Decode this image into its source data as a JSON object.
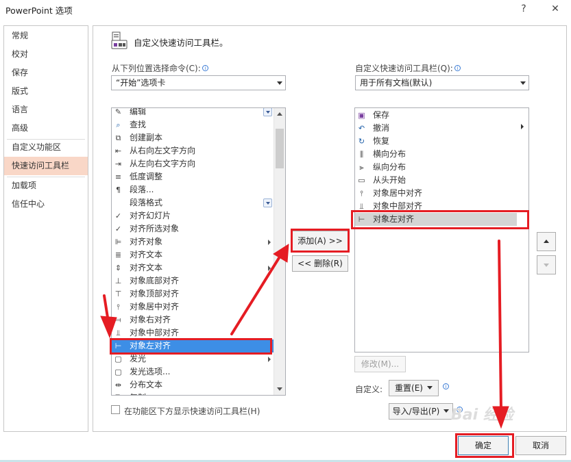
{
  "window": {
    "title": "PowerPoint 选项",
    "help": "?",
    "close": "✕"
  },
  "nav": {
    "items": [
      "常规",
      "校对",
      "保存",
      "版式",
      "语言",
      "高级",
      "自定义功能区",
      "快速访问工具栏",
      "加载项",
      "信任中心"
    ],
    "selected_index": 7
  },
  "header": {
    "title": "自定义快速访问工具栏。"
  },
  "left": {
    "label": "从下列位置选择命令(C):",
    "dropdown_value": "“开始”选项卡",
    "items": [
      {
        "label": "编辑",
        "icon": "edit-icon"
      },
      {
        "label": "查找",
        "icon": "find-icon"
      },
      {
        "label": "创建副本",
        "icon": "duplicate-icon"
      },
      {
        "label": "从右向左文字方向",
        "icon": "rtl-icon"
      },
      {
        "label": "从左向右文字方向",
        "icon": "ltr-icon"
      },
      {
        "label": "低度调整",
        "icon": "lines-icon"
      },
      {
        "label": "段落...",
        "icon": "paragraph-icon"
      },
      {
        "label": "段落格式",
        "icon": ""
      },
      {
        "label": "对齐幻灯片",
        "icon": "check-icon"
      },
      {
        "label": "对齐所选对象",
        "icon": "check-icon"
      },
      {
        "label": "对齐对象",
        "icon": "align-icon"
      },
      {
        "label": "对齐文本",
        "icon": "align-text-icon"
      },
      {
        "label": "对齐文本",
        "icon": "align-text-v-icon"
      },
      {
        "label": "对象底部对齐",
        "icon": "align-bottom-icon"
      },
      {
        "label": "对象顶部对齐",
        "icon": "align-top-icon"
      },
      {
        "label": "对象居中对齐",
        "icon": "align-center-icon"
      },
      {
        "label": "对象右对齐",
        "icon": "align-right-icon"
      },
      {
        "label": "对象中部对齐",
        "icon": "align-middle-icon"
      },
      {
        "label": "对象左对齐",
        "icon": "align-left-icon"
      },
      {
        "label": "发光",
        "icon": "glow-icon"
      },
      {
        "label": "发光选项...",
        "icon": "glow-options-icon"
      },
      {
        "label": "分布文本",
        "icon": "distribute-icon"
      },
      {
        "label": "复制",
        "icon": "copy-icon"
      }
    ],
    "checkbox_label": "在功能区下方显示快速访问工具栏(H)"
  },
  "right": {
    "label": "自定义快速访问工具栏(Q):",
    "dropdown_value": "用于所有文档(默认)",
    "items": [
      {
        "label": "保存",
        "icon": "save-icon"
      },
      {
        "label": "撤消",
        "icon": "undo-icon"
      },
      {
        "label": "恢复",
        "icon": "redo-icon"
      },
      {
        "label": "横向分布",
        "icon": "distribute-h-icon"
      },
      {
        "label": "纵向分布",
        "icon": "distribute-v-icon"
      },
      {
        "label": "从头开始",
        "icon": "slideshow-icon"
      },
      {
        "label": "对象居中对齐",
        "icon": "align-center-icon"
      },
      {
        "label": "对象中部对齐",
        "icon": "align-middle-icon"
      },
      {
        "label": "对象左对齐",
        "icon": "align-left-icon"
      }
    ],
    "modify": "修改(M)...",
    "customize_label": "自定义:",
    "reset": "重置(E)",
    "import_export": "导入/导出(P)"
  },
  "buttons": {
    "add": "添加(A) >>",
    "remove": "<< 删除(R)",
    "ok": "确定",
    "cancel": "取消"
  },
  "watermark": "Bai 经验"
}
